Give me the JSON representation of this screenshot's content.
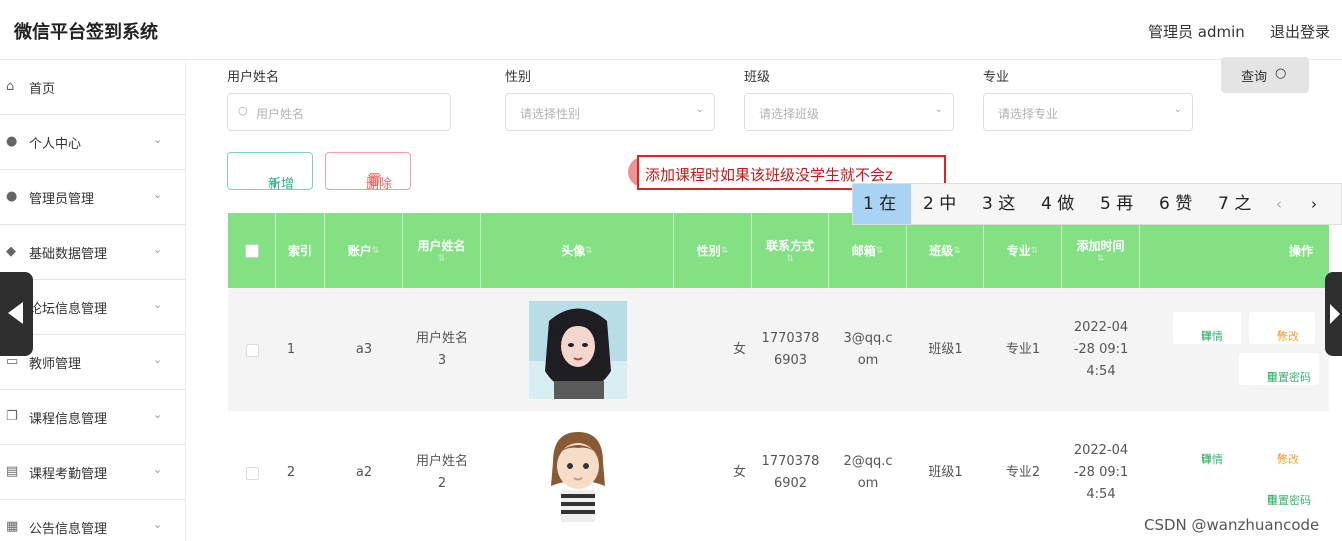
{
  "header": {
    "title": "微信平台签到系统",
    "admin": "管理员 admin",
    "logout": "退出登录"
  },
  "sidebar": {
    "items": [
      {
        "label": "首页",
        "icon": "home-icon",
        "has_chevron": false
      },
      {
        "label": "个人中心",
        "icon": "user-icon",
        "has_chevron": true
      },
      {
        "label": "管理员管理",
        "icon": "user-icon",
        "has_chevron": true
      },
      {
        "label": "基础数据管理",
        "icon": "location-icon",
        "has_chevron": true
      },
      {
        "label": "论坛信息管理",
        "icon": "forum-icon",
        "has_chevron": true
      },
      {
        "label": "教师管理",
        "icon": "message-icon",
        "has_chevron": true
      },
      {
        "label": "课程信息管理",
        "icon": "copy-icon",
        "has_chevron": true
      },
      {
        "label": "课程考勤管理",
        "icon": "clipboard-icon",
        "has_chevron": true
      },
      {
        "label": "公告信息管理",
        "icon": "grid-icon",
        "has_chevron": true
      }
    ]
  },
  "filters": {
    "username": {
      "label": "用户姓名",
      "placeholder": "用户姓名"
    },
    "gender": {
      "label": "性别",
      "placeholder": "请选择性别"
    },
    "class": {
      "label": "班级",
      "placeholder": "请选择班级"
    },
    "major": {
      "label": "专业",
      "placeholder": "请选择专业"
    },
    "search_button": "查询"
  },
  "actions": {
    "add": "新增",
    "delete": "删除"
  },
  "ime": {
    "composition": "添加课程时如果该班级没学生就不会z",
    "candidates": [
      "1 在",
      "2 中",
      "3 这",
      "4 做",
      "5 再",
      "6 赞",
      "7 之"
    ],
    "prev": "‹",
    "next": "›"
  },
  "table": {
    "headers": [
      "索引",
      "账户",
      "用户姓名",
      "头像",
      "性别",
      "联系方式",
      "邮箱",
      "班级",
      "专业",
      "添加时间",
      "操作"
    ],
    "rows": [
      {
        "index": "1",
        "account": "a3",
        "name_l1": "用户姓名",
        "name_l2": "3",
        "gender": "女",
        "phone_l1": "1770378",
        "phone_l2": "6903",
        "email_l1": "3@qq.c",
        "email_l2": "om",
        "class": "班级1",
        "major": "专业1",
        "time_l1": "2022-04",
        "time_l2": "-28 09:1",
        "time_l3": "4:54"
      },
      {
        "index": "2",
        "account": "a2",
        "name_l1": "用户姓名",
        "name_l2": "2",
        "gender": "女",
        "phone_l1": "1770378",
        "phone_l2": "6902",
        "email_l1": "2@qq.c",
        "email_l2": "om",
        "class": "班级1",
        "major": "专业2",
        "time_l1": "2022-04",
        "time_l2": "-28 09:1",
        "time_l3": "4:54"
      }
    ],
    "row_actions": {
      "detail": "详情",
      "edit": "修改",
      "reset": "重置密码"
    }
  },
  "watermark": "CSDN @wanzhuancode"
}
